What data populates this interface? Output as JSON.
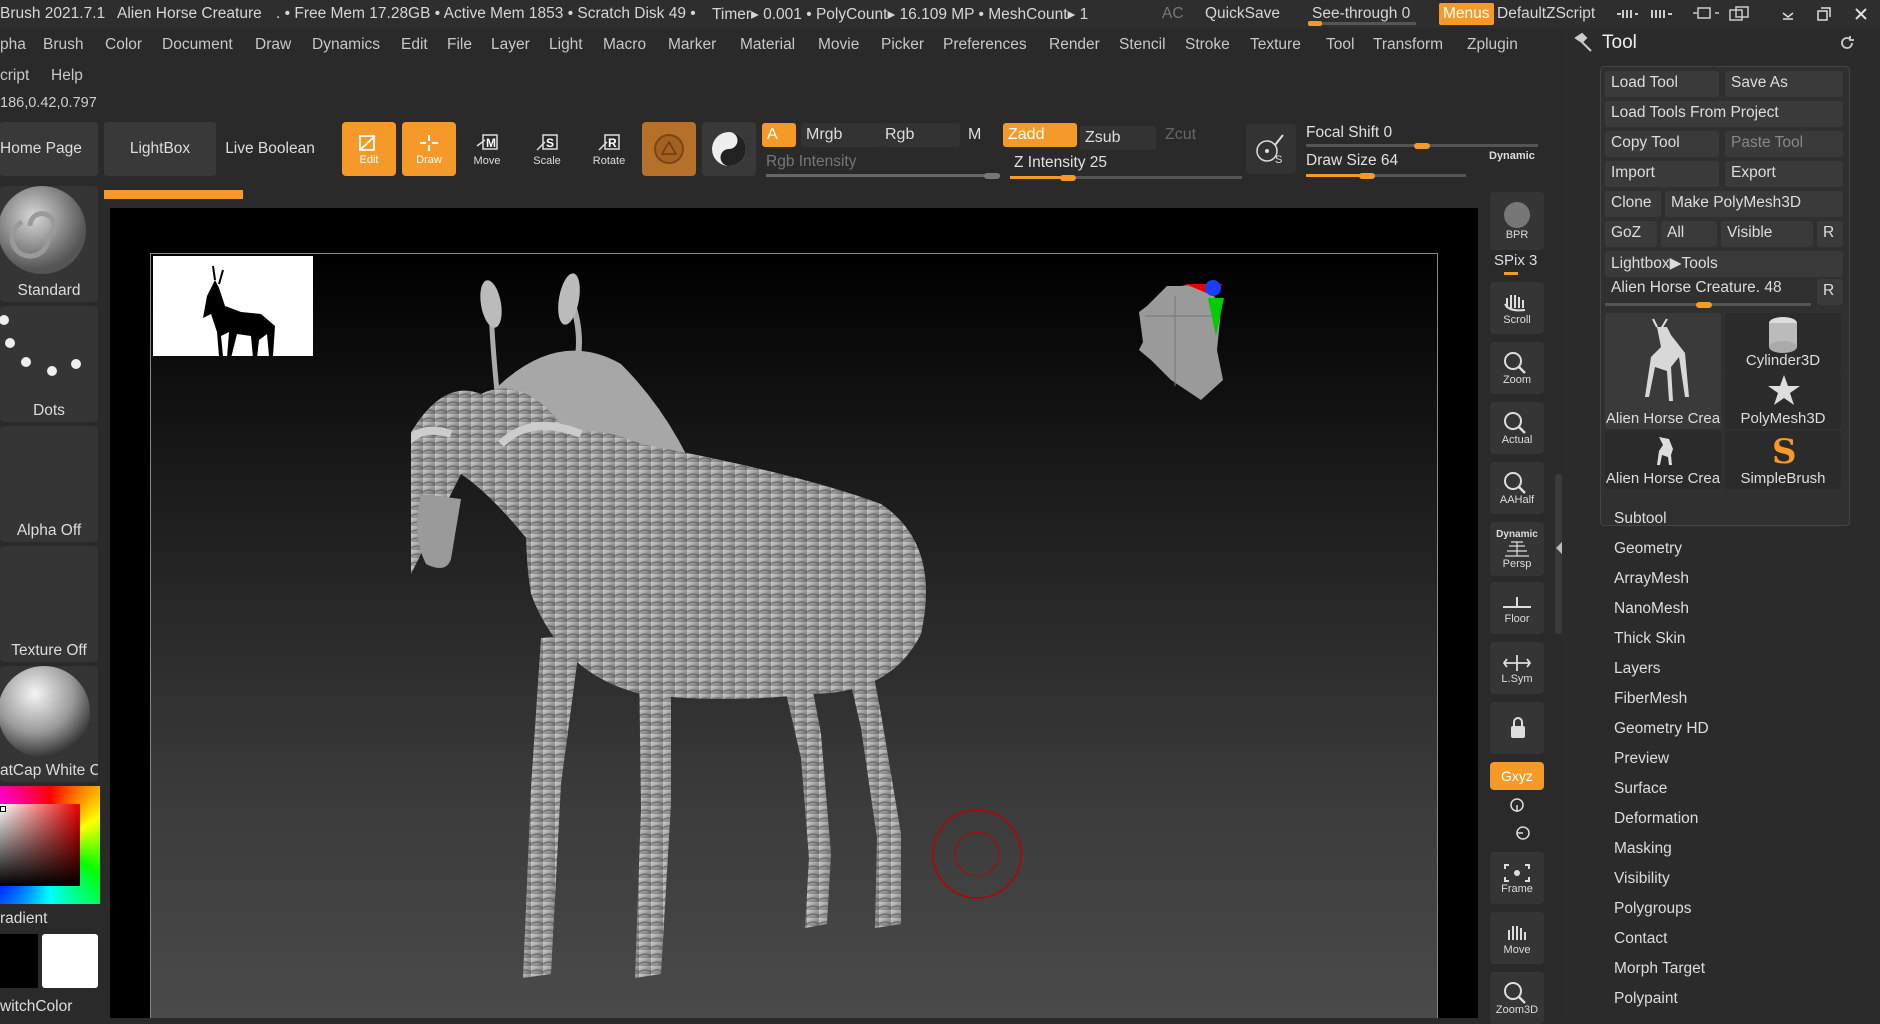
{
  "titlebar": {
    "app": "Brush 2021.7.1",
    "doc": "Alien Horse Creature",
    "stats": ". • Free Mem 17.28GB • Active Mem 1853 • Scratch Disk 49 •",
    "timer": "Timer▸ 0.001 • PolyCount▸ 16.109 MP • MeshCount▸ 1",
    "ac": "AC",
    "quicksave": "QuickSave",
    "seethrough": "See-through  0",
    "menus": "Menus",
    "script": "DefaultZScript"
  },
  "menu": [
    "pha",
    "Brush",
    "Color",
    "Document",
    "Draw",
    "Dynamics",
    "Edit",
    "File",
    "Layer",
    "Light",
    "Macro",
    "Marker",
    "Material",
    "Movie",
    "Picker",
    "Preferences",
    "Render",
    "Stencil",
    "Stroke",
    "Texture",
    "Tool",
    "Transform",
    "Zplugin"
  ],
  "menu2": [
    "cript",
    "Help"
  ],
  "coord": "186,0.42,0.797",
  "toolbar": {
    "home": "Home Page",
    "lightbox": "LightBox",
    "liveboolean": "Live Boolean",
    "edit": "Edit",
    "draw": "Draw",
    "move": "Move",
    "scale": "Scale",
    "rotate": "Rotate",
    "a": "A",
    "mrgb": "Mrgb",
    "rgb": "Rgb",
    "m": "M",
    "rgb_intensity": "Rgb Intensity",
    "zadd": "Zadd",
    "zsub": "Zsub",
    "zcut": "Zcut",
    "z_intensity": "Z Intensity 25",
    "focal_shift": "Focal Shift 0",
    "draw_size": "Draw Size 64",
    "dynamic": "Dynamic"
  },
  "left": {
    "standard": "Standard",
    "dots": "Dots",
    "alpha": "Alpha Off",
    "texture": "Texture Off",
    "matcap": "atCap White C",
    "gradient": "radient",
    "switchcolor": "witchColor"
  },
  "right": {
    "bpr": "BPR",
    "spix": "SPix 3",
    "scroll": "Scroll",
    "zoom": "Zoom",
    "actual": "Actual",
    "aahalf": "AAHalf",
    "dynamic": "Dynamic",
    "persp": "Persp",
    "floor": "Floor",
    "lsym": "L.Sym",
    "xyz": "Gxyz",
    "frame": "Frame",
    "move": "Move",
    "zoom3d": "Zoom3D"
  },
  "tool": {
    "title": "Tool",
    "load": "Load Tool",
    "saveas": "Save As",
    "loadproject": "Load Tools From Project",
    "copy": "Copy Tool",
    "paste": "Paste Tool",
    "import": "Import",
    "export": "Export",
    "clone": "Clone",
    "makepoly": "Make PolyMesh3D",
    "goz": "GoZ",
    "all": "All",
    "visible": "Visible",
    "r": "R",
    "lightbox": "Lightbox▶Tools",
    "current": "Alien Horse Creature. 48",
    "thumbs": [
      "Alien Horse Crea",
      "Cylinder3D",
      "PolyMesh3D",
      "Alien Horse Crea",
      "SimpleBrush"
    ],
    "items": [
      "Subtool",
      "Geometry",
      "ArrayMesh",
      "NanoMesh",
      "Thick Skin",
      "Layers",
      "FiberMesh",
      "Geometry HD",
      "Preview",
      "Surface",
      "Deformation",
      "Masking",
      "Visibility",
      "Polygroups",
      "Contact",
      "Morph Target",
      "Polypaint"
    ]
  },
  "sliders": {
    "rgb_intensity": 1.0,
    "z_intensity": 0.25,
    "focal_shift": 0.5,
    "draw_size": 0.38,
    "seethrough": 0.0,
    "current_tool": 0.48
  },
  "colors": {
    "accent": "#f59a28",
    "panel": "#2b2b2b"
  }
}
